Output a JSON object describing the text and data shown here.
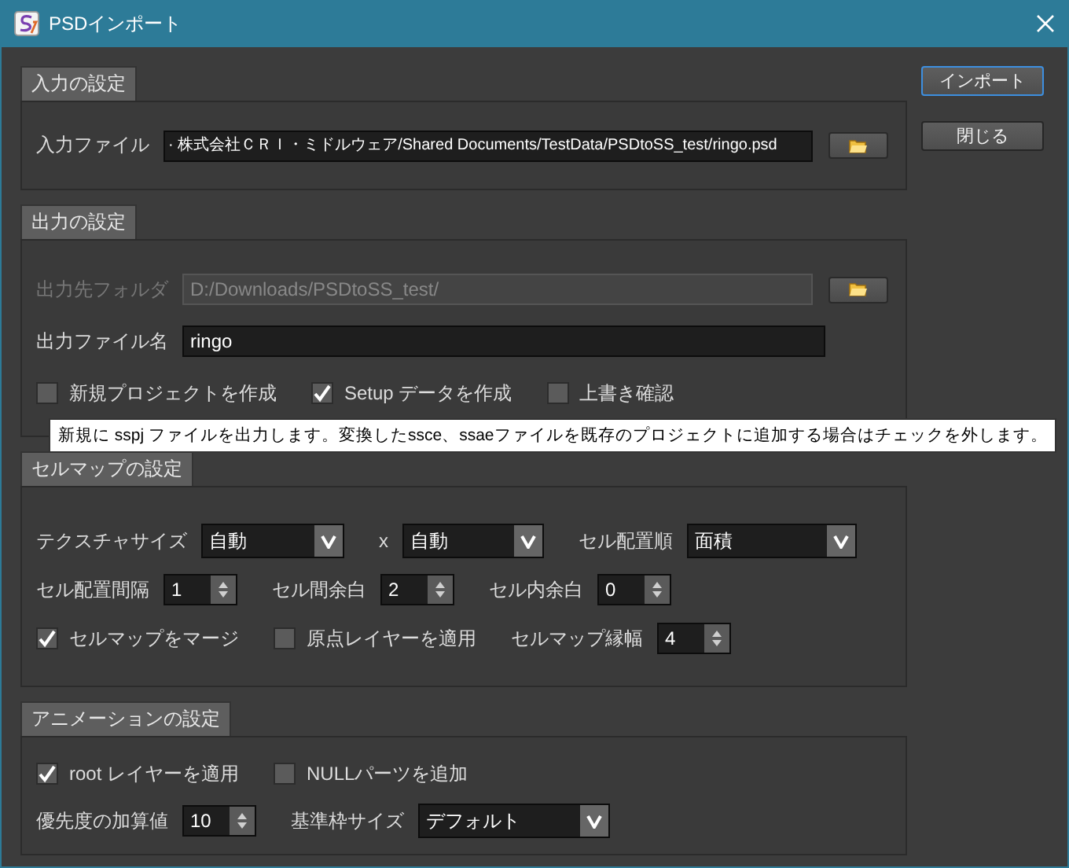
{
  "window": {
    "title": "PSDインポート"
  },
  "buttons": [
    {
      "label": "インポート",
      "focused": true
    },
    {
      "label": "閉じる",
      "focused": false
    }
  ],
  "sections": [
    {
      "title": "入力の設定",
      "rows": [
        {
          "items": [
            {
              "kind": "field",
              "label": "入力ファイル",
              "value": "· 株式会社ＣＲＩ・ミドルウェア/Shared Documents/TestData/PSDtoSS_test/ringo.psd",
              "disabled": false,
              "browse": true
            }
          ]
        }
      ]
    },
    {
      "title": "出力の設定",
      "rows": [
        {
          "items": [
            {
              "kind": "field",
              "label": "出力先フォルダ",
              "value": "D:/Downloads/PSDtoSS_test/",
              "disabled": true,
              "browse": true
            }
          ]
        },
        {
          "items": [
            {
              "kind": "field",
              "label": "出力ファイル名",
              "value": "ringo",
              "disabled": false,
              "browse": false
            }
          ]
        },
        {
          "items": [
            {
              "kind": "checkbox",
              "label": "新規プロジェクトを作成",
              "checked": false
            },
            {
              "kind": "checkbox",
              "label": "Setup データを作成",
              "checked": true
            },
            {
              "kind": "checkbox",
              "label": "上書き確認",
              "checked": false
            }
          ]
        }
      ]
    },
    {
      "title": "セルマップの設定",
      "rows": [
        {
          "items": [
            {
              "kind": "combo",
              "label": "テクスチャサイズ",
              "value": "自動"
            },
            {
              "kind": "combo",
              "label": "x",
              "value": "自動"
            },
            {
              "kind": "combo",
              "label": "セル配置順",
              "value": "面積"
            }
          ]
        },
        {
          "items": [
            {
              "kind": "spin",
              "label": "セル配置間隔",
              "value": "1"
            },
            {
              "kind": "spin",
              "label": "セル間余白",
              "value": "2"
            },
            {
              "kind": "spin",
              "label": "セル内余白",
              "value": "0"
            }
          ]
        },
        {
          "items": [
            {
              "kind": "checkbox",
              "label": "セルマップをマージ",
              "checked": true
            },
            {
              "kind": "checkbox",
              "label": "原点レイヤーを適用",
              "checked": false
            },
            {
              "kind": "spin",
              "label": "セルマップ縁幅",
              "value": "4"
            }
          ]
        }
      ]
    },
    {
      "title": "アニメーションの設定",
      "rows": [
        {
          "items": [
            {
              "kind": "checkbox",
              "label": "root レイヤーを適用",
              "checked": true
            },
            {
              "kind": "checkbox",
              "label": "NULLパーツを追加",
              "checked": false
            }
          ]
        },
        {
          "items": [
            {
              "kind": "spin",
              "label": "優先度の加算値",
              "value": "10"
            },
            {
              "kind": "combo",
              "label": "基準枠サイズ",
              "value": "デフォルト"
            }
          ]
        }
      ]
    }
  ],
  "tooltip": {
    "text": "新規に sspj ファイルを出力します。変換したssce、ssaeファイルを既存のプロジェクトに追加する場合はチェックを外します。"
  }
}
